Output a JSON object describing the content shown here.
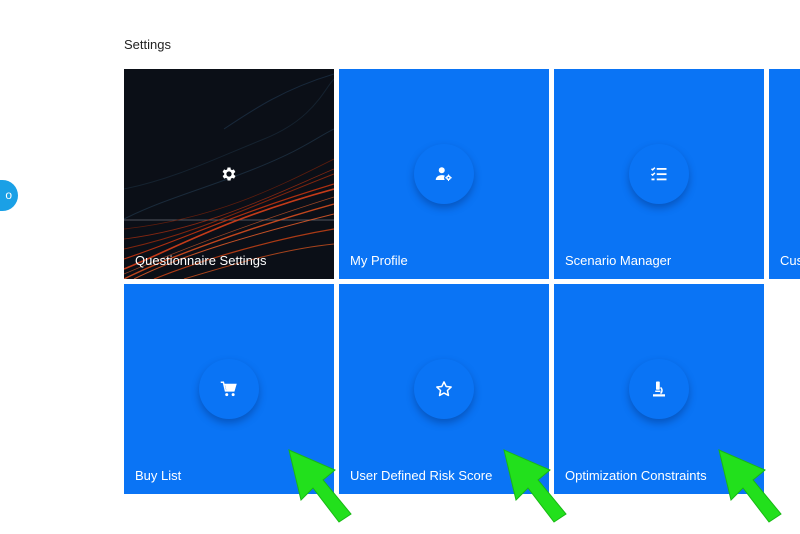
{
  "page_title": "Settings",
  "side_badge": "o",
  "tiles": [
    {
      "label": "Questionnaire Settings",
      "icon": "gear-icon"
    },
    {
      "label": "My Profile",
      "icon": "user-settings-icon"
    },
    {
      "label": "Scenario Manager",
      "icon": "checklist-icon"
    },
    {
      "label": "Cus",
      "icon": ""
    },
    {
      "label": "Buy List",
      "icon": "cart-icon"
    },
    {
      "label": "User Defined Risk Score",
      "icon": "star-icon"
    },
    {
      "label": "Optimization Constraints",
      "icon": "microscope-icon"
    }
  ],
  "colors": {
    "tile_blue": "#0a74f5",
    "arrow_green": "#22e01c",
    "badge_blue": "#1aa0e6"
  }
}
